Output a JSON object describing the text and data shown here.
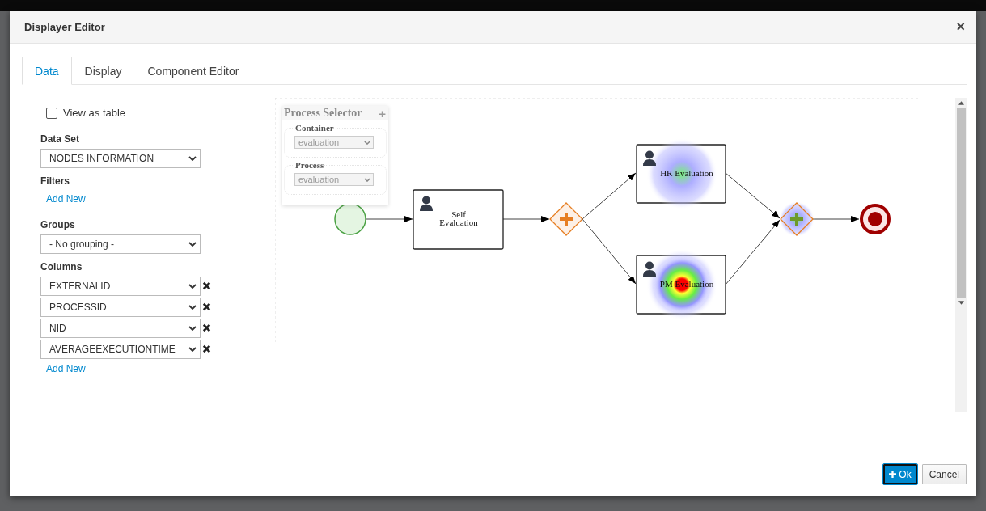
{
  "dialog": {
    "title": "Displayer Editor",
    "close": "×"
  },
  "tabs": [
    {
      "label": "Data",
      "selected": true
    },
    {
      "label": "Display",
      "selected": false
    },
    {
      "label": "Component Editor",
      "selected": false
    }
  ],
  "view_as_table": {
    "label": "View as table",
    "checked": false
  },
  "data_set": {
    "label": "Data Set",
    "value": "NODES INFORMATION"
  },
  "filters": {
    "label": "Filters",
    "add": "Add New"
  },
  "groups": {
    "label": "Groups",
    "value": "- No grouping -"
  },
  "columns": {
    "label": "Columns",
    "add": "Add New",
    "items": [
      "EXTERNALID",
      "PROCESSID",
      "NID",
      "AVERAGEEXECUTIONTIME"
    ]
  },
  "process_selector": {
    "title": "Process Selector",
    "expand": "+",
    "fields": [
      {
        "label": "Container",
        "value": "evaluation",
        "disabled": true
      },
      {
        "label": "Process",
        "value": "evaluation",
        "disabled": true
      }
    ]
  },
  "diagram": {
    "nodes": [
      {
        "kind": "start",
        "heated": false,
        "hot": false
      },
      {
        "kind": "task",
        "label": [
          "Self",
          "Evaluation"
        ],
        "heated": false,
        "hot": false
      },
      {
        "kind": "gateway",
        "heated": false,
        "hot": false
      },
      {
        "kind": "task",
        "label": [
          "HR Evaluation"
        ],
        "heated": true,
        "hot": false
      },
      {
        "kind": "task",
        "label": [
          "PM Evaluation"
        ],
        "heated": true,
        "hot": true
      },
      {
        "kind": "gateway",
        "heated": true,
        "hot": false
      },
      {
        "kind": "end",
        "heated": false,
        "hot": false
      }
    ]
  },
  "buttons": [
    {
      "label": "Ok",
      "primary": true
    },
    {
      "label": "Cancel",
      "primary": false
    }
  ]
}
